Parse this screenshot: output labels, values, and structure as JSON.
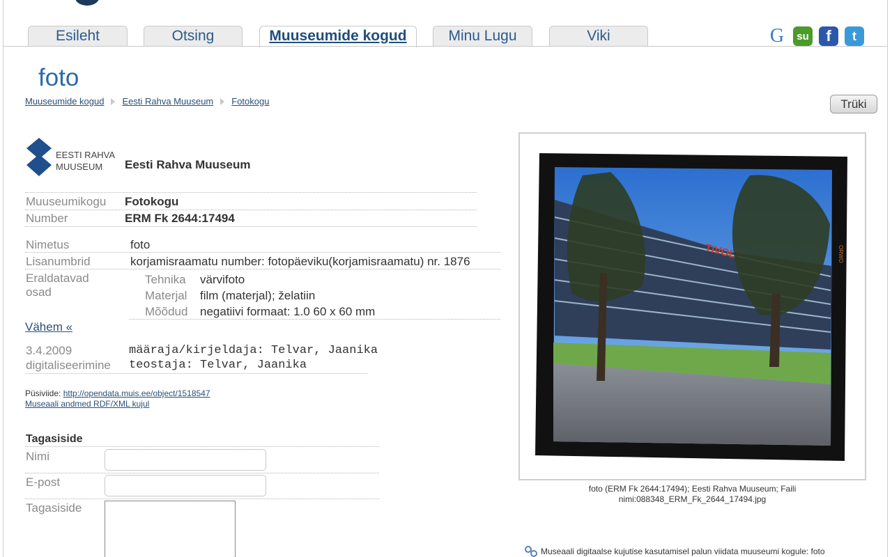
{
  "tabs": [
    {
      "label": "Esileht"
    },
    {
      "label": "Otsing"
    },
    {
      "label": "Muuseumide kogud",
      "active": true
    },
    {
      "label": "Minu Lugu"
    },
    {
      "label": "Viki"
    }
  ],
  "social": {
    "google_label": "G",
    "stumbleupon_label": "su",
    "facebook_label": "f",
    "twitter_label": "t",
    "icons": [
      "google-icon",
      "stumbleupon-icon",
      "facebook-icon",
      "twitter-icon"
    ]
  },
  "page": {
    "title": "foto",
    "print_label": "Trüki"
  },
  "breadcrumb": [
    "Muuseumide kogud",
    "Eesti Rahva Muuseum",
    "Fotokogu"
  ],
  "museum": {
    "logo_line1": "EESTI RAHVA",
    "logo_line2": "MUUSEUM",
    "name": "Eesti Rahva Muuseum",
    "brand_color": "#1f4f8c"
  },
  "record": {
    "collection_label": "Muuseumikogu",
    "collection_value": "Fotokogu",
    "number_label": "Number",
    "number_value": "ERM Fk 2644:17494",
    "name_label": "Nimetus",
    "name_value": "foto",
    "extra_label": "Lisanumbrid",
    "extra_value": "korjamisraamatu number: fotopäeviku(korjamisraamatu) nr. 1876",
    "parts_label_1": "Eraldatavad",
    "parts_label_2": "osad",
    "parts": [
      {
        "label": "Tehnika",
        "value": "värvifoto"
      },
      {
        "label": "Materjal",
        "value": "film (materjal); želatiin"
      },
      {
        "label": "Mõõdud",
        "value": "negatiivi formaat: 1.0 60 x 60 mm"
      }
    ],
    "less_link": "Vähem «",
    "date_label": "3.4.2009",
    "date_sublabel": "digitaliseerimine",
    "roles": [
      "määraja/kirjeldaja: Telvar, Jaanika",
      "teostaja: Telvar, Jaanika"
    ]
  },
  "links": {
    "permalink_label": "Püsiviide: ",
    "permalink_url": "http://opendata.muis.ee/object/1518547",
    "rdf_link": "Museaali andmed RDF/XML kujul"
  },
  "feedback": {
    "title": "Tagasiside",
    "name_label": "Nimi",
    "name_value": "",
    "email_label": "E-post",
    "email_value": "",
    "message_label": "Tagasiside",
    "message_value": ""
  },
  "photo": {
    "caption_line1": "foto (ERM Fk 2644:17494); Eesti Rahva Muuseum; Faili",
    "caption_line2": "nimi:088348_ERM_Fk_2644_17494.jpg",
    "building_sign": "TIVOLI",
    "film_edge_text": "ORWO"
  },
  "footer": {
    "note": "Museaali digitaalse kujutise kasutamisel palun viidata muuseumi kogule: foto"
  }
}
